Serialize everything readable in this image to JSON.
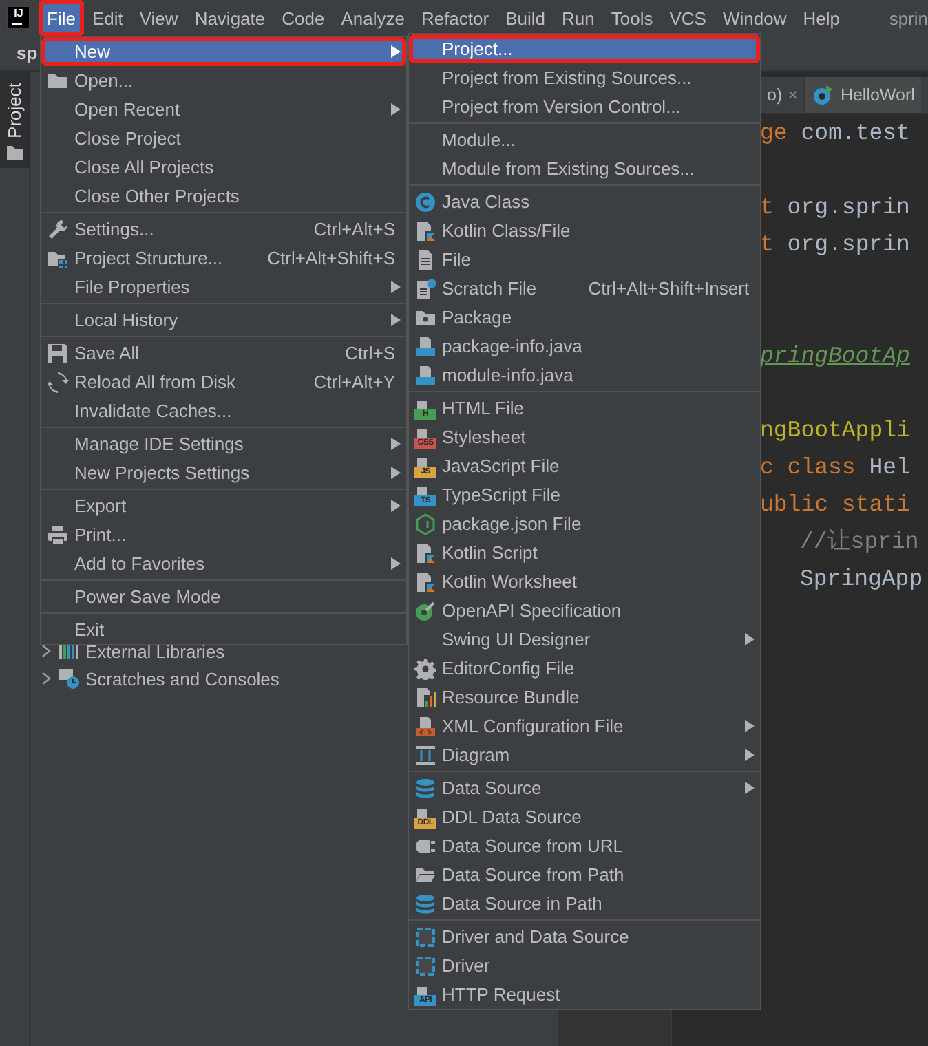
{
  "menubar": {
    "logo_text": "IJ",
    "items": [
      {
        "label": "File",
        "selected": true,
        "highlighted": true
      },
      {
        "label": "Edit",
        "selected": false,
        "highlighted": false
      },
      {
        "label": "View",
        "selected": false,
        "highlighted": false
      },
      {
        "label": "Navigate",
        "selected": false,
        "highlighted": false
      },
      {
        "label": "Code",
        "selected": false,
        "highlighted": false
      },
      {
        "label": "Analyze",
        "selected": false,
        "highlighted": false
      },
      {
        "label": "Refactor",
        "selected": false,
        "highlighted": false
      },
      {
        "label": "Build",
        "selected": false,
        "highlighted": false
      },
      {
        "label": "Run",
        "selected": false,
        "highlighted": false
      },
      {
        "label": "Tools",
        "selected": false,
        "highlighted": false
      },
      {
        "label": "VCS",
        "selected": false,
        "highlighted": false
      },
      {
        "label": "Window",
        "selected": false,
        "highlighted": false
      },
      {
        "label": "Help",
        "selected": false,
        "highlighted": false
      }
    ],
    "project_name": "sprin"
  },
  "toolbar": {
    "breadcrumb": "sp"
  },
  "tool_window_tab": {
    "label": "Project"
  },
  "project_tree": {
    "items": [
      {
        "label": "External Libraries",
        "kind": "libraries"
      },
      {
        "label": "Scratches and Consoles",
        "kind": "scratches"
      }
    ]
  },
  "editor": {
    "tabs": [
      {
        "label": "o)",
        "close": "×",
        "kind": "plain"
      },
      {
        "label": "HelloWorl",
        "kind": "file"
      }
    ],
    "lines": [
      {
        "kind": "code",
        "indent": false,
        "segments": [
          {
            "text": "ge",
            "kind": "keyword"
          },
          {
            "text": " com.test",
            "kind": "plain"
          }
        ]
      },
      {
        "kind": "blank"
      },
      {
        "kind": "code",
        "indent": false,
        "segments": [
          {
            "text": "t",
            "kind": "keyword"
          },
          {
            "text": " org.sprin",
            "kind": "plain"
          }
        ]
      },
      {
        "kind": "code",
        "indent": false,
        "segments": [
          {
            "text": "t",
            "kind": "keyword"
          },
          {
            "text": " org.sprin",
            "kind": "plain"
          }
        ]
      },
      {
        "kind": "blank"
      },
      {
        "kind": "blank"
      },
      {
        "kind": "code",
        "indent": false,
        "segments": [
          {
            "text": "pringBootAp",
            "kind": "link"
          }
        ]
      },
      {
        "kind": "blank"
      },
      {
        "kind": "code",
        "indent": false,
        "segments": [
          {
            "text": "ngBootAppli",
            "kind": "annotation"
          }
        ]
      },
      {
        "kind": "code",
        "indent": false,
        "segments": [
          {
            "text": "c class",
            "kind": "keyword"
          },
          {
            "text": " Hel",
            "kind": "plain"
          }
        ]
      },
      {
        "kind": "code",
        "indent": false,
        "segments": [
          {
            "text": "ublic stati",
            "kind": "keyword"
          }
        ]
      },
      {
        "kind": "code",
        "indent": true,
        "segments": [
          {
            "text": "//让sprin",
            "kind": "comment"
          }
        ]
      },
      {
        "kind": "code",
        "indent": true,
        "segments": [
          {
            "text": "SpringApp",
            "kind": "plain"
          }
        ]
      }
    ]
  },
  "file_menu": {
    "items": [
      {
        "kind": "plain",
        "label": "New",
        "submenu": true,
        "selected": true,
        "highlighted": true
      },
      {
        "kind": "folder",
        "label": "Open...",
        "submenu": false,
        "selected": false,
        "highlighted": false
      },
      {
        "kind": "plain",
        "label": "Open Recent",
        "submenu": true,
        "selected": false,
        "highlighted": false
      },
      {
        "kind": "plain",
        "label": "Close Project",
        "submenu": false,
        "selected": false,
        "highlighted": false
      },
      {
        "kind": "plain",
        "label": "Close All Projects",
        "submenu": false,
        "selected": false,
        "highlighted": false
      },
      {
        "kind": "plain",
        "label": "Close Other Projects",
        "submenu": false,
        "selected": false,
        "highlighted": false
      },
      {
        "kind": "separator"
      },
      {
        "kind": "wrench",
        "label": "Settings...",
        "shortcut": "Ctrl+Alt+S",
        "submenu": false,
        "selected": false,
        "highlighted": false
      },
      {
        "kind": "structure",
        "label": "Project Structure...",
        "shortcut": "Ctrl+Alt+Shift+S",
        "submenu": false,
        "selected": false,
        "highlighted": false
      },
      {
        "kind": "plain",
        "label": "File Properties",
        "submenu": true,
        "selected": false,
        "highlighted": false
      },
      {
        "kind": "separator"
      },
      {
        "kind": "plain",
        "label": "Local History",
        "submenu": true,
        "selected": false,
        "highlighted": false
      },
      {
        "kind": "separator"
      },
      {
        "kind": "floppy",
        "label": "Save All",
        "shortcut": "Ctrl+S",
        "submenu": false,
        "selected": false,
        "highlighted": false
      },
      {
        "kind": "reload",
        "label": "Reload All from Disk",
        "shortcut": "Ctrl+Alt+Y",
        "submenu": false,
        "selected": false,
        "highlighted": false
      },
      {
        "kind": "plain",
        "label": "Invalidate Caches...",
        "submenu": false,
        "selected": false,
        "highlighted": false
      },
      {
        "kind": "separator"
      },
      {
        "kind": "plain",
        "label": "Manage IDE Settings",
        "submenu": true,
        "selected": false,
        "highlighted": false
      },
      {
        "kind": "plain",
        "label": "New Projects Settings",
        "submenu": true,
        "selected": false,
        "highlighted": false
      },
      {
        "kind": "separator"
      },
      {
        "kind": "plain",
        "label": "Export",
        "submenu": true,
        "selected": false,
        "highlighted": false
      },
      {
        "kind": "printer",
        "label": "Print...",
        "submenu": false,
        "selected": false,
        "highlighted": false
      },
      {
        "kind": "plain",
        "label": "Add to Favorites",
        "submenu": true,
        "selected": false,
        "highlighted": false
      },
      {
        "kind": "separator"
      },
      {
        "kind": "plain",
        "label": "Power Save Mode",
        "submenu": false,
        "selected": false,
        "highlighted": false
      },
      {
        "kind": "separator"
      },
      {
        "kind": "plain",
        "label": "Exit",
        "submenu": false,
        "selected": false,
        "highlighted": false
      }
    ]
  },
  "new_submenu": {
    "items": [
      {
        "kind": "plain",
        "label": "Project...",
        "submenu": false,
        "selected": true,
        "highlighted": true
      },
      {
        "kind": "plain",
        "label": "Project from Existing Sources...",
        "submenu": false,
        "selected": false,
        "highlighted": false
      },
      {
        "kind": "plain",
        "label": "Project from Version Control...",
        "submenu": false,
        "selected": false,
        "highlighted": false
      },
      {
        "kind": "separator"
      },
      {
        "kind": "plain",
        "label": "Module...",
        "submenu": false,
        "selected": false,
        "highlighted": false
      },
      {
        "kind": "plain",
        "label": "Module from Existing Sources...",
        "submenu": false,
        "selected": false,
        "highlighted": false
      },
      {
        "kind": "separator"
      },
      {
        "kind": "class",
        "label": "Java Class",
        "submenu": false,
        "selected": false,
        "highlighted": false
      },
      {
        "kind": "kotlin",
        "label": "Kotlin Class/File",
        "submenu": false,
        "selected": false,
        "highlighted": false
      },
      {
        "kind": "file",
        "label": "File",
        "submenu": false,
        "selected": false,
        "highlighted": false
      },
      {
        "kind": "scratch",
        "label": "Scratch File",
        "shortcut": "Ctrl+Alt+Shift+Insert",
        "submenu": false,
        "selected": false,
        "highlighted": false
      },
      {
        "kind": "package",
        "label": "Package",
        "submenu": false,
        "selected": false,
        "highlighted": false
      },
      {
        "kind": "java",
        "label": "package-info.java",
        "submenu": false,
        "selected": false,
        "highlighted": false
      },
      {
        "kind": "java",
        "label": "module-info.java",
        "submenu": false,
        "selected": false,
        "highlighted": false
      },
      {
        "kind": "separator"
      },
      {
        "kind": "html",
        "label": "HTML File",
        "icon_text": "H",
        "submenu": false,
        "selected": false,
        "highlighted": false
      },
      {
        "kind": "css",
        "label": "Stylesheet",
        "icon_text": "CSS",
        "submenu": false,
        "selected": false,
        "highlighted": false
      },
      {
        "kind": "js",
        "label": "JavaScript File",
        "icon_text": "JS",
        "submenu": false,
        "selected": false,
        "highlighted": false
      },
      {
        "kind": "ts",
        "label": "TypeScript File",
        "icon_text": "TS",
        "submenu": false,
        "selected": false,
        "highlighted": false
      },
      {
        "kind": "hexagon",
        "label": "package.json File",
        "submenu": false,
        "selected": false,
        "highlighted": false
      },
      {
        "kind": "kotlin",
        "label": "Kotlin Script",
        "submenu": false,
        "selected": false,
        "highlighted": false
      },
      {
        "kind": "kotlin",
        "label": "Kotlin Worksheet",
        "submenu": false,
        "selected": false,
        "highlighted": false
      },
      {
        "kind": "openapi",
        "label": "OpenAPI Specification",
        "submenu": false,
        "selected": false,
        "highlighted": false
      },
      {
        "kind": "plain",
        "label": "Swing UI Designer",
        "submenu": true,
        "selected": false,
        "highlighted": false
      },
      {
        "kind": "gear",
        "label": "EditorConfig File",
        "submenu": false,
        "selected": false,
        "highlighted": false
      },
      {
        "kind": "bundle",
        "label": "Resource Bundle",
        "submenu": false,
        "selected": false,
        "highlighted": false
      },
      {
        "kind": "xml",
        "label": "XML Configuration File",
        "submenu": true,
        "selected": false,
        "highlighted": false
      },
      {
        "kind": "diagram",
        "label": "Diagram",
        "submenu": true,
        "selected": false,
        "highlighted": false
      },
      {
        "kind": "separator"
      },
      {
        "kind": "database",
        "label": "Data Source",
        "submenu": true,
        "selected": false,
        "highlighted": false
      },
      {
        "kind": "ddl",
        "label": "DDL Data Source",
        "icon_text": "DDL",
        "submenu": false,
        "selected": false,
        "highlighted": false
      },
      {
        "kind": "plug",
        "label": "Data Source from URL",
        "submenu": false,
        "selected": false,
        "highlighted": false
      },
      {
        "kind": "openfolder",
        "label": "Data Source from Path",
        "submenu": false,
        "selected": false,
        "highlighted": false
      },
      {
        "kind": "database",
        "label": "Data Source in Path",
        "submenu": false,
        "selected": false,
        "highlighted": false
      },
      {
        "kind": "separator"
      },
      {
        "kind": "driver",
        "label": "Driver and Data Source",
        "submenu": false,
        "selected": false,
        "highlighted": false
      },
      {
        "kind": "driver",
        "label": "Driver",
        "submenu": false,
        "selected": false,
        "highlighted": false
      },
      {
        "kind": "api",
        "label": "HTTP Request",
        "icon_text": "API",
        "submenu": false,
        "selected": false,
        "highlighted": false
      }
    ]
  }
}
